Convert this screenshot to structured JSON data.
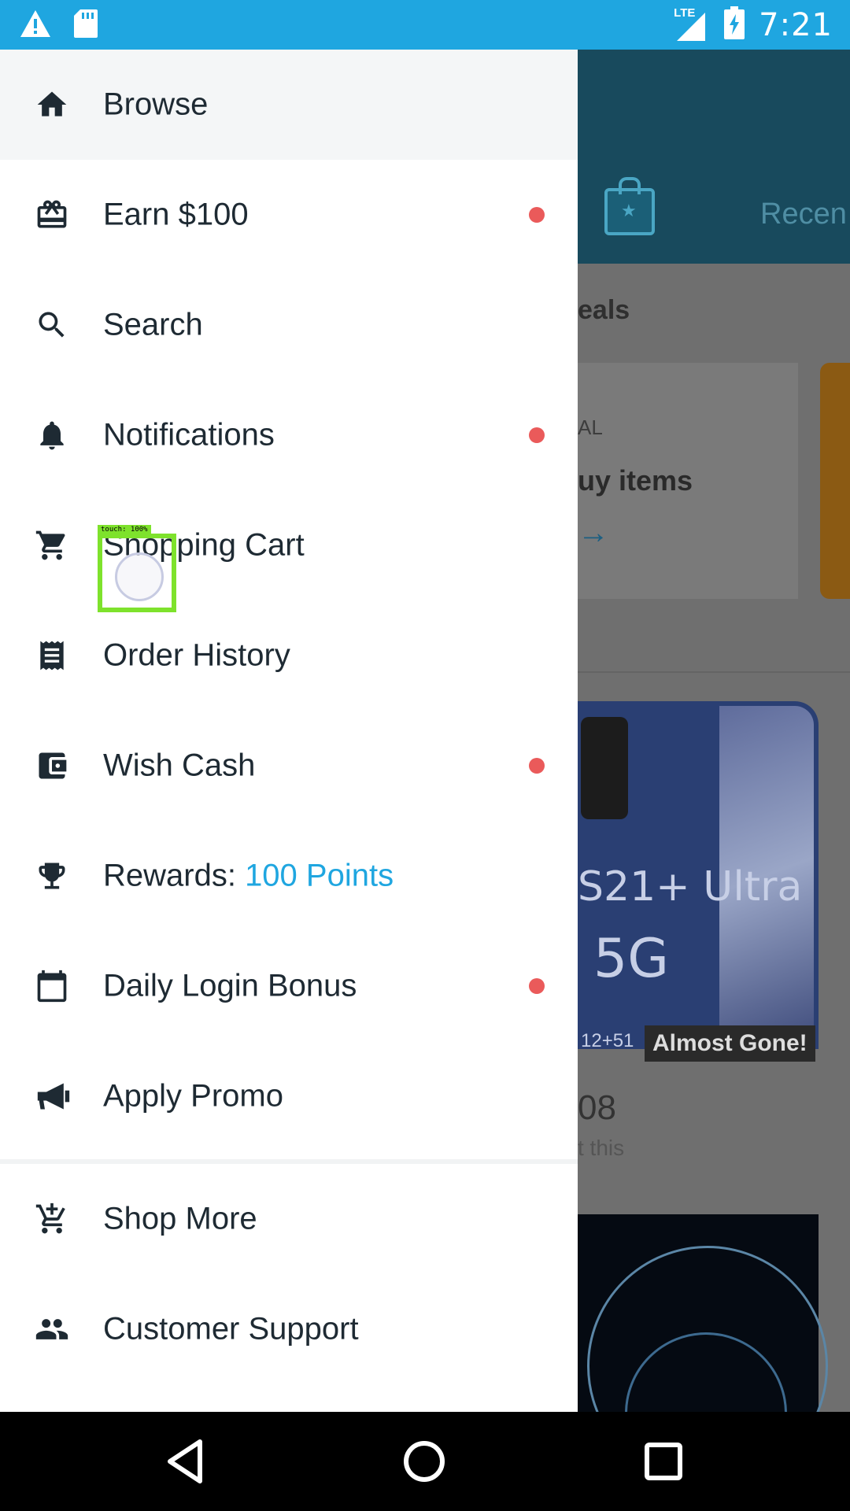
{
  "status_bar": {
    "time": "7:21",
    "network": "LTE",
    "icons": [
      "warning-icon",
      "sd-card-icon",
      "signal-icon",
      "battery-charging-icon"
    ]
  },
  "drawer": {
    "items": [
      {
        "icon": "home-icon",
        "label": "Browse",
        "active": true
      },
      {
        "icon": "gift-icon",
        "label": "Earn $100",
        "badge": true
      },
      {
        "icon": "search-icon",
        "label": "Search"
      },
      {
        "icon": "bell-icon",
        "label": "Notifications",
        "badge": true
      },
      {
        "icon": "cart-icon",
        "label": "Shopping Cart"
      },
      {
        "icon": "receipt-icon",
        "label": "Order History"
      },
      {
        "icon": "wallet-icon",
        "label": "Wish Cash",
        "badge": true
      },
      {
        "icon": "trophy-icon",
        "label": "Rewards: ",
        "points": "100 Points"
      },
      {
        "icon": "calendar-icon",
        "label": "Daily Login Bonus",
        "badge": true
      },
      {
        "icon": "megaphone-icon",
        "label": "Apply Promo"
      },
      {
        "icon": "add-cart-icon",
        "label": "Shop More"
      },
      {
        "icon": "people-icon",
        "label": "Customer Support"
      }
    ]
  },
  "background": {
    "tab_recent": "Recen",
    "section_title": "eals",
    "card_tag": "AL",
    "card_title": "uy items",
    "phone_model": "S21+ Ultra",
    "phone_network": "5G",
    "phone_sub": "12+51",
    "badge": "Almost Gone!",
    "price": "08",
    "price_sub": "t this"
  },
  "touch": {
    "label": "touch: 100%"
  },
  "colors": {
    "accent": "#1fa6e0",
    "badge": "#ea5a5a",
    "text": "#1e2a33"
  }
}
